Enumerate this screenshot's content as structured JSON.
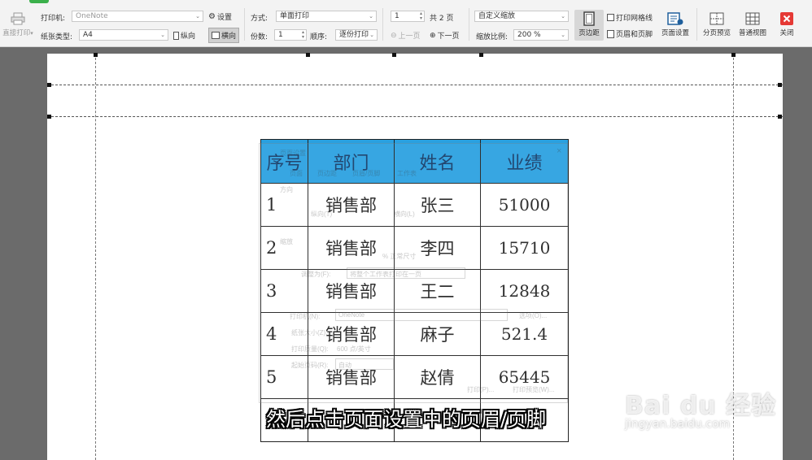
{
  "toolbar": {
    "direct_print": "直接打印",
    "printer_label": "打印机:",
    "printer_value": "OneNote",
    "settings_label": "设置",
    "paper_type_label": "纸张类型:",
    "paper_type_value": "A4",
    "portrait_label": "纵向",
    "landscape_label": "横向",
    "mode_label": "方式:",
    "mode_value": "单面打印",
    "copies_label": "份数:",
    "copies_value": "1",
    "order_label": "顺序:",
    "order_value": "逐份打印",
    "page_value": "1",
    "total_pages": "共 2 页",
    "prev_page": "上一页",
    "next_page": "下一页",
    "scale_mode": "自定义缩放",
    "zoom_label": "缩放比例:",
    "zoom_value": "200 %",
    "margins_btn": "页边距",
    "gridlines_label": "打印网格线",
    "header_footer_label": "页眉和页脚",
    "page_setup_btn": "页面设置",
    "page_break_btn": "分页预览",
    "normal_view_btn": "普通视图",
    "close_btn": "关闭"
  },
  "table": {
    "headers": [
      "序号",
      "部门",
      "姓名",
      "业绩"
    ],
    "rows": [
      [
        "1",
        "销售部",
        "张三",
        "51000"
      ],
      [
        "2",
        "销售部",
        "李四",
        "15710"
      ],
      [
        "3",
        "销售部",
        "王二",
        "12848"
      ],
      [
        "4",
        "销售部",
        "麻子",
        "521.4"
      ],
      [
        "5",
        "销售部",
        "赵倩",
        "65445"
      ]
    ]
  },
  "ghost_dialog": {
    "title": "页面设置",
    "tabs": [
      "页面",
      "页边距",
      "页眉/页脚",
      "工作表"
    ],
    "orientation": "方向",
    "portrait": "纵向(T)",
    "landscape": "横向(L)",
    "scaling": "缩放",
    "scale_pct": "% 正常尺寸",
    "fit_to": "调整为(F):",
    "fit_value": "将整个工作表打印在一页",
    "printer": "打印机(N):",
    "printer_value": "OneNote",
    "options": "选项(O)...",
    "paper_size": "纸张大小(Z):",
    "print_quality": "打印质量(Q):",
    "quality_value": "600 点/英寸",
    "first_page": "起始页码(R):",
    "first_page_value": "自动",
    "print_btn": "打印(P)...",
    "preview_btn": "打印预览(W)...",
    "close_x": "×"
  },
  "subtitle": "然后点击页面设置中的页眉/页脚",
  "watermark": {
    "logo": "Bai du 经验",
    "url": "jingyan.baidu.com"
  },
  "colors": {
    "header_blue": "#29a0e0",
    "close_red": "#e53935",
    "accent_green": "#3bb04b"
  }
}
